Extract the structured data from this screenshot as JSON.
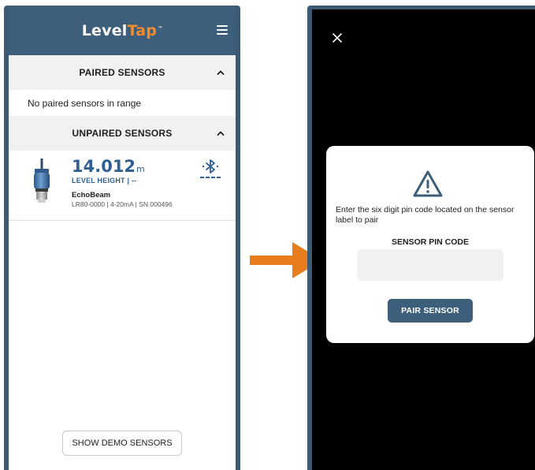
{
  "left_screen": {
    "header": {
      "logo_level": "Level",
      "logo_tap": "Tap",
      "logo_tm": "™",
      "menu_icon": "hamburger-menu-icon"
    },
    "paired": {
      "title": "PAIRED SENSORS",
      "empty_text": "No paired sensors in range"
    },
    "unpaired": {
      "title": "UNPAIRED SENSORS",
      "sensors": [
        {
          "reading": "14.012",
          "unit": "m",
          "label": "LEVEL HEIGHT | --",
          "model": "EchoBeam",
          "detail": "LR80-0000 | 4-20mA | SN 000496",
          "icon": "bluetooth-icon"
        }
      ]
    },
    "demo_button": "SHOW DEMO SENSORS"
  },
  "right_screen": {
    "close_icon": "close-icon",
    "modal": {
      "icon": "warning-icon",
      "message": "Enter the six digit pin code located on the sensor label to pair",
      "pin_label": "SENSOR PIN CODE",
      "pin_value": "",
      "pair_button": "PAIR SENSOR"
    }
  },
  "colors": {
    "brand_blue": "#3e5f7b",
    "accent_orange": "#f08b2f",
    "arrow_orange": "#e87d1e",
    "reading_blue": "#2f5f93"
  }
}
